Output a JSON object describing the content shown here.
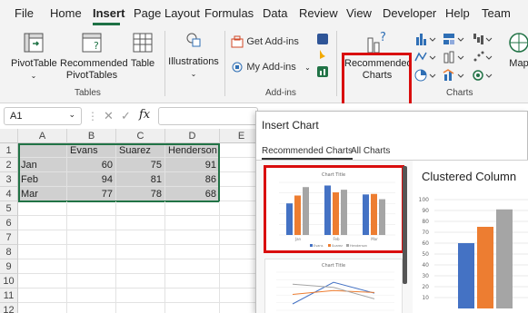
{
  "menu": {
    "tabs": [
      "File",
      "Home",
      "Insert",
      "Page Layout",
      "Formulas",
      "Data",
      "Review",
      "View",
      "Developer",
      "Help",
      "Team"
    ],
    "active_tab": "Insert"
  },
  "ribbon": {
    "tables": {
      "pivot_label_1": "PivotTable",
      "recpivot_label_1": "Recommended",
      "recpivot_label_2": "PivotTables",
      "table_label": "Table",
      "group_label": "Tables"
    },
    "illustrations": {
      "label": "Illustrations"
    },
    "addins": {
      "get_addins": "Get Add-ins",
      "my_addins": "My Add-ins",
      "group_label": "Add-ins"
    },
    "charts": {
      "rec_label_1": "Recommended",
      "rec_label_2": "Charts",
      "maps_label": "Map",
      "group_label": "Charts"
    },
    "accent": "#d90d0d"
  },
  "formula_bar": {
    "name_box": "A1",
    "fx": "fx",
    "cancel": "✕",
    "enter": "✓"
  },
  "sheet": {
    "columns": [
      "A",
      "B",
      "C",
      "D",
      "E"
    ],
    "rows": [
      "1",
      "2",
      "3",
      "4",
      "5",
      "6",
      "7",
      "8",
      "9",
      "10",
      "11",
      "12"
    ],
    "header_row": [
      "",
      "Evans",
      "Suarez",
      "Henderson"
    ],
    "data": [
      [
        "Jan",
        "60",
        "75",
        "91"
      ],
      [
        "Feb",
        "94",
        "81",
        "86"
      ],
      [
        "Mar",
        "77",
        "78",
        "68"
      ]
    ]
  },
  "dialog": {
    "title": "Insert Chart",
    "tabs": [
      "Recommended Charts",
      "All Charts"
    ],
    "preview_title": "Clustered Column",
    "preview_ticks": [
      "100",
      "90",
      "80",
      "70",
      "60",
      "50",
      "40",
      "30",
      "20",
      "10"
    ],
    "thumb_chart_title": "Chart Title",
    "thumb_categories": [
      "Jan",
      "Feb",
      "Mar"
    ],
    "thumb_legend": [
      "Evans",
      "Suarez",
      "Henderson"
    ],
    "series_colors": [
      "#4472c4",
      "#ed7d31",
      "#a5a5a5"
    ]
  },
  "chart_data": {
    "type": "bar",
    "categories": [
      "Jan",
      "Feb",
      "Mar"
    ],
    "series": [
      {
        "name": "Evans",
        "values": [
          60,
          94,
          77
        ]
      },
      {
        "name": "Suarez",
        "values": [
          75,
          81,
          78
        ]
      },
      {
        "name": "Henderson",
        "values": [
          91,
          86,
          68
        ]
      }
    ],
    "title": "Chart Title",
    "ylim": [
      0,
      100
    ]
  }
}
